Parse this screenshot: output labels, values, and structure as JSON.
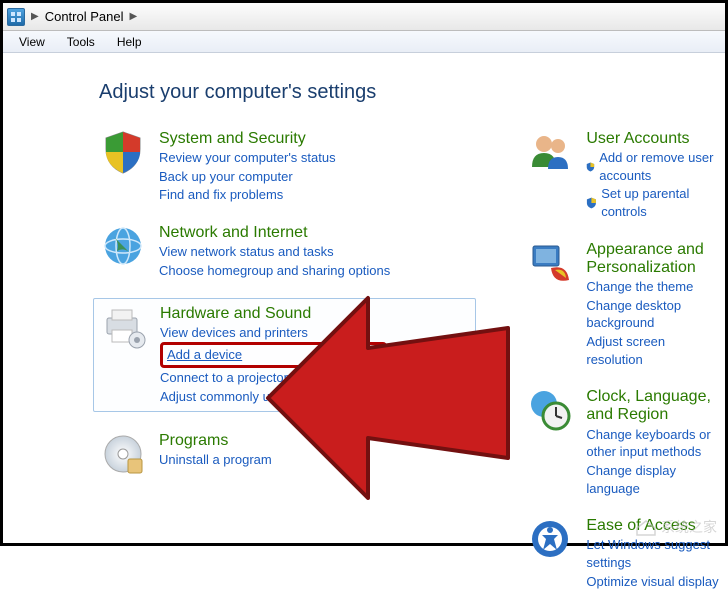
{
  "breadcrumb": {
    "root": "Control Panel"
  },
  "menu": {
    "view": "View",
    "tools": "Tools",
    "help": "Help"
  },
  "heading": "Adjust your computer's settings",
  "left": {
    "sys": {
      "title": "System and Security",
      "l1": "Review your computer's status",
      "l2": "Back up your computer",
      "l3": "Find and fix problems"
    },
    "net": {
      "title": "Network and Internet",
      "l1": "View network status and tasks",
      "l2": "Choose homegroup and sharing options"
    },
    "hw": {
      "title": "Hardware and Sound",
      "l1": "View devices and printers",
      "l2": "Add a device",
      "l3": "Connect to a projector",
      "l4": "Adjust commonly used mobility settings"
    },
    "prog": {
      "title": "Programs",
      "l1": "Uninstall a program"
    }
  },
  "right": {
    "ua": {
      "title": "User Accounts",
      "l1": "Add or remove user accounts",
      "l2": "Set up parental controls"
    },
    "appear": {
      "title": "Appearance and Personalization",
      "l1": "Change the theme",
      "l2": "Change desktop background",
      "l3": "Adjust screen resolution"
    },
    "clock": {
      "title": "Clock, Language, and Region",
      "l1": "Change keyboards or other input methods",
      "l2": "Change display language"
    },
    "ease": {
      "title": "Ease of Access",
      "l1": "Let Windows suggest settings",
      "l2": "Optimize visual display"
    }
  },
  "watermark": "系统之家"
}
